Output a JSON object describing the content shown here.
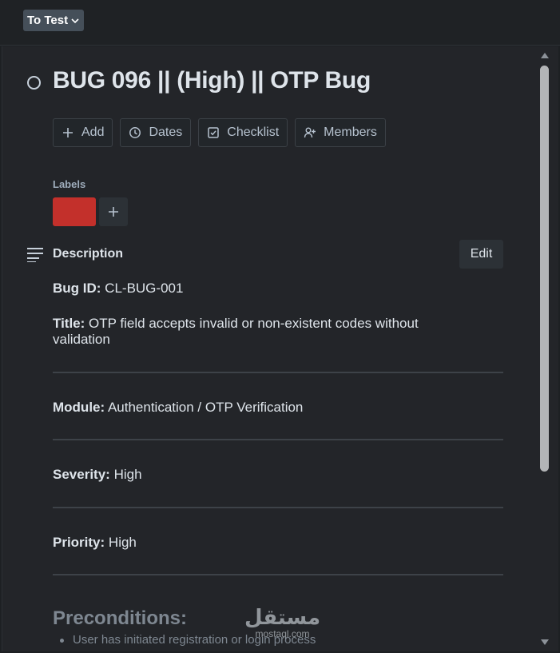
{
  "list_status": {
    "label": "To Test"
  },
  "card": {
    "title": "BUG 096 || (High) || OTP Bug",
    "actions": [
      {
        "label": "Add",
        "icon": "plus-icon"
      },
      {
        "label": "Dates",
        "icon": "clock-icon"
      },
      {
        "label": "Checklist",
        "icon": "checkbox-icon"
      },
      {
        "label": "Members",
        "icon": "add-person-icon"
      }
    ],
    "labels": {
      "heading": "Labels",
      "chip_color": "#c3302b"
    },
    "description": {
      "heading": "Description",
      "edit_label": "Edit",
      "fields": [
        {
          "key": "Bug ID:",
          "value": "CL-BUG-001"
        },
        {
          "key": "Title:",
          "value": "OTP field accepts invalid or non-existent codes without validation"
        },
        {
          "key": "Module:",
          "value": "Authentication / OTP Verification"
        },
        {
          "key": "Severity:",
          "value": "High"
        },
        {
          "key": "Priority:",
          "value": "High"
        }
      ],
      "preconditions_heading": "Preconditions:",
      "preconditions": [
        "User has initiated registration or login process"
      ]
    }
  },
  "watermark": {
    "arabic": "مستقل",
    "latin": "mostaql.com"
  }
}
